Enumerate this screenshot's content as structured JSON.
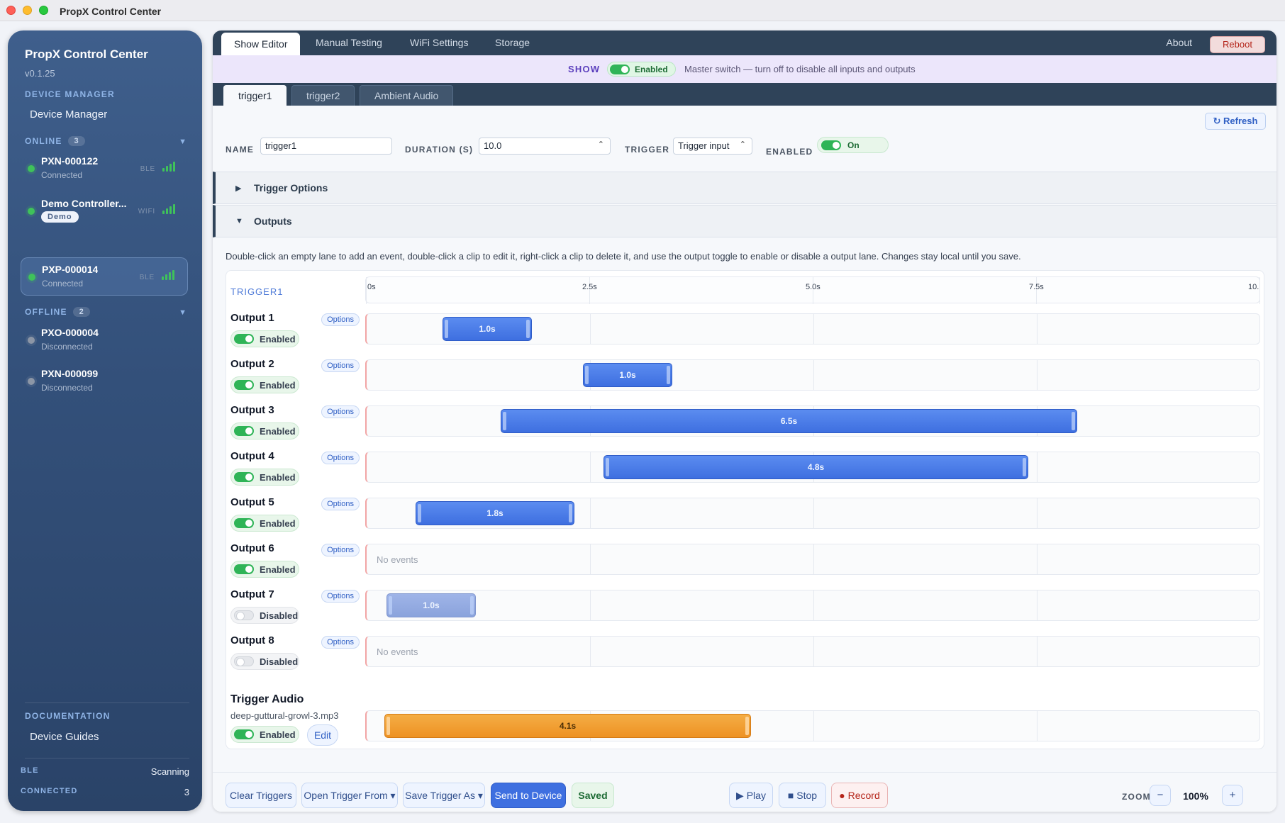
{
  "window": {
    "title": "PropX Control Center"
  },
  "sidebar": {
    "title": "PropX Control Center",
    "version": "v0.1.25",
    "device_manager_section": "DEVICE MANAGER",
    "device_manager_link": "Device Manager",
    "online": {
      "label": "ONLINE",
      "count": "3"
    },
    "offline": {
      "label": "OFFLINE",
      "count": "2"
    },
    "online_devices": [
      {
        "name": "PXN-000122",
        "status": "Connected",
        "conn": "BLE",
        "selected": false
      },
      {
        "name": "Demo Controller...",
        "badge": "Demo",
        "conn": "WIFI",
        "selected": false
      },
      {
        "name": "PXP-000014",
        "status": "Connected",
        "conn": "BLE",
        "selected": true
      }
    ],
    "offline_devices": [
      {
        "name": "PXO-000004",
        "status": "Disconnected"
      },
      {
        "name": "PXN-000099",
        "status": "Disconnected"
      }
    ],
    "documentation_section": "DOCUMENTATION",
    "device_guides_link": "Device Guides",
    "footer": {
      "ble_label": "BLE",
      "ble_value": "Scanning",
      "connected_label": "CONNECTED",
      "connected_value": "3"
    }
  },
  "topnav": {
    "tabs": [
      "Show Editor",
      "Manual Testing",
      "WiFi Settings",
      "Storage"
    ],
    "active": "Show Editor",
    "about": "About",
    "reboot": "Reboot"
  },
  "showbar": {
    "label": "SHOW",
    "toggle": "Enabled",
    "help": "Master switch — turn off to disable all inputs and outputs"
  },
  "trigger_tabs": [
    "trigger1",
    "trigger2",
    "Ambient Audio"
  ],
  "editor": {
    "refresh": "↻ Refresh",
    "name_label": "NAME",
    "name_value": "trigger1",
    "duration_label": "DURATION (S)",
    "duration_value": "10.0",
    "trigger_label": "TRIGGER",
    "trigger_value": "Trigger input",
    "enabled_label": "ENABLED",
    "enabled_value": "On",
    "trigger_options": "Trigger Options",
    "outputs": "Outputs",
    "help": "Double-click an empty lane to add an event, double-click a clip to edit it, right-click a clip to delete it, and use the output toggle to enable or disable a output lane. Changes stay local until you save."
  },
  "timeline": {
    "trigger_name": "TRIGGER1",
    "duration": 10.0,
    "ticks": [
      "0s",
      "2.5s",
      "5.0s",
      "7.5s",
      "10."
    ],
    "tick_values": [
      0,
      2.5,
      5.0,
      7.5,
      10.0
    ],
    "options_label": "Options",
    "no_events": "No events",
    "outputs": [
      {
        "name": "Output 1",
        "enabled": true,
        "toggle": "Enabled",
        "clips": [
          {
            "start": 0.85,
            "dur": 1.0,
            "label": "1.0s"
          }
        ]
      },
      {
        "name": "Output 2",
        "enabled": true,
        "toggle": "Enabled",
        "clips": [
          {
            "start": 2.42,
            "dur": 1.0,
            "label": "1.0s"
          }
        ]
      },
      {
        "name": "Output 3",
        "enabled": true,
        "toggle": "Enabled",
        "clips": [
          {
            "start": 1.5,
            "dur": 6.45,
            "label": "6.5s"
          }
        ]
      },
      {
        "name": "Output 4",
        "enabled": true,
        "toggle": "Enabled",
        "clips": [
          {
            "start": 2.65,
            "dur": 4.75,
            "label": "4.8s"
          }
        ]
      },
      {
        "name": "Output 5",
        "enabled": true,
        "toggle": "Enabled",
        "clips": [
          {
            "start": 0.55,
            "dur": 1.78,
            "label": "1.8s"
          }
        ]
      },
      {
        "name": "Output 6",
        "enabled": true,
        "toggle": "Enabled",
        "clips": []
      },
      {
        "name": "Output 7",
        "enabled": false,
        "toggle": "Disabled",
        "clips": [
          {
            "start": 0.22,
            "dur": 1.0,
            "label": "1.0s"
          }
        ]
      },
      {
        "name": "Output 8",
        "enabled": false,
        "toggle": "Disabled",
        "clips": []
      }
    ],
    "audio": {
      "name": "Trigger Audio",
      "file": "deep-guttural-growl-3.mp3",
      "toggle": "Enabled",
      "edit": "Edit",
      "clip": {
        "start": 0.2,
        "dur": 4.1,
        "label": "4.1s"
      }
    }
  },
  "bottombar": {
    "clear": "Clear Triggers",
    "open": "Open Trigger From ▾",
    "save_as": "Save Trigger As ▾",
    "send": "Send to Device",
    "saved": "Saved",
    "play": "▶ Play",
    "stop": "■ Stop",
    "record": "● Record",
    "zoom_label": "ZOOM",
    "zoom_minus": "−",
    "zoom_value": "100%",
    "zoom_plus": "+"
  }
}
